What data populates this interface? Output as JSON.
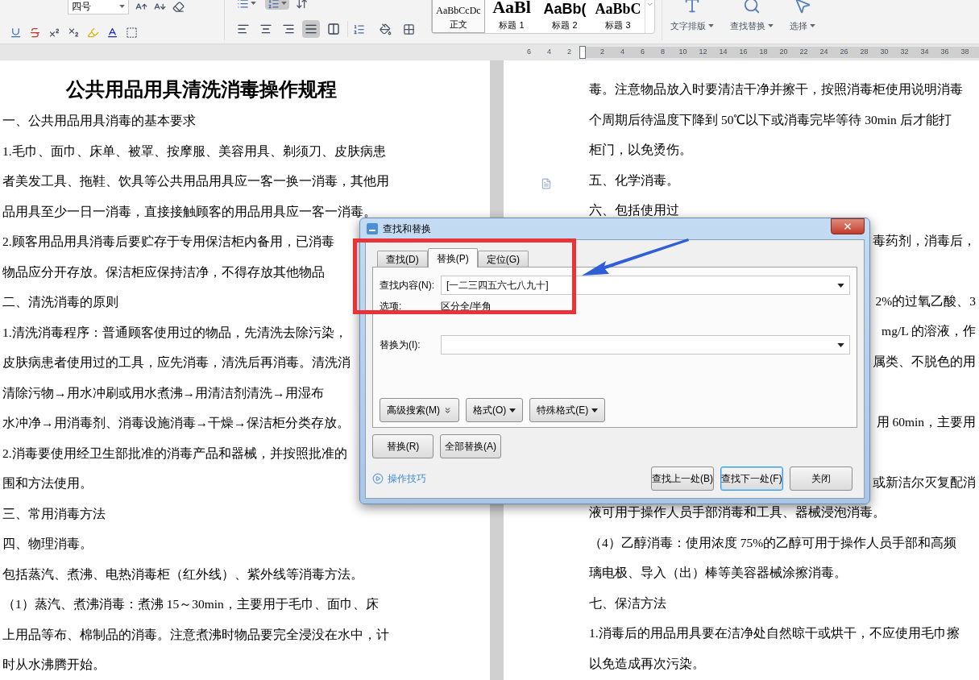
{
  "toolbar": {
    "font_size": "四号",
    "list_buttons": [
      {
        "kind": "bullets",
        "selected": false
      },
      {
        "kind": "numbering",
        "selected": true
      }
    ],
    "align_buttons": [
      {
        "kind": "left",
        "selected": false
      },
      {
        "kind": "center",
        "selected": false
      },
      {
        "kind": "right",
        "selected": false
      },
      {
        "kind": "justify",
        "selected": true
      },
      {
        "kind": "distributed",
        "selected": false
      }
    ],
    "styles": [
      {
        "kind": "body",
        "sample": "AaBbCcDc",
        "name": "正文",
        "selected": true
      },
      {
        "kind": "heading1",
        "sample": "AaBl",
        "name": "标题 1",
        "selected": false
      },
      {
        "kind": "heading2",
        "sample": "AaBb(",
        "name": "标题 2",
        "selected": false
      },
      {
        "kind": "heading3",
        "sample": "AaBbC",
        "name": "标题 3",
        "selected": false
      }
    ],
    "big_buttons": [
      {
        "kind": "layout",
        "label": "文字排版"
      },
      {
        "kind": "find",
        "label": "查找替换"
      },
      {
        "kind": "select",
        "label": "选择"
      }
    ]
  },
  "ruler": {
    "left_ticks": [
      "6",
      "4",
      "2"
    ],
    "right_ticks": [
      "2",
      "4",
      "6",
      "8",
      "10",
      "12",
      "14",
      "16",
      "18",
      "20",
      "22",
      "24",
      "26",
      "28",
      "30",
      "32",
      "34",
      "36",
      "38"
    ]
  },
  "left_page": {
    "title": "公共用品用具清洗消毒操作规程",
    "lines": [
      "一、公共用品用具消毒的基本要求",
      "1.毛巾、面巾、床单、被罩、按摩服、美容用具、剃须刀、皮肤病患",
      "者美发工具、拖鞋、饮具等公共用品用具应一客一换一消毒，其他用",
      "品用具至少一日一消毒，直接接触顾客的用品用具应一客一消毒。",
      "2.顾客用品用具消毒后要贮存于专用保洁柜内备用，已消毒",
      "物品应分开存放。保洁柜应保持洁净，不得存放其他物品",
      "二、清洗消毒的原则",
      "1.清洗消毒程序：普通顾客使用过的物品，先清洗去除污染，",
      "皮肤病患者使用过的工具，应先消毒，清洗后再消毒。清洗消",
      "清除污物→用水冲刷或用水煮沸→用清洁剂清洗→用湿布",
      "水冲净→用消毒剂、消毒设施消毒→干燥→保洁柜分类存放。",
      "2.消毒要使用经卫生部批准的消毒产品和器械，并按照批准的",
      "围和方法使用。",
      "三、常用消毒方法",
      "四、物理消毒。",
      "包括蒸汽、煮沸、电热消毒柜（红外线）、紫外线等消毒方法。",
      "（1）蒸汽、煮沸消毒：煮沸 15～30min，主要用于毛巾、面巾、床",
      "上用品等布、棉制品的消毒。注意煮沸时物品要完全浸没在水中，计",
      "时从水沸腾开始。"
    ]
  },
  "right_page": {
    "lines": [
      {
        "kind": "full",
        "text": "毒。注意物品放入时要清洁干净并擦干，按照消毒柜使用说明消毒"
      },
      {
        "kind": "full",
        "text": "个周期后待温度下降到 50℃以下或消毒完毕等待 30min 后才能打"
      },
      {
        "kind": "full",
        "text": "柜门，以免烫伤。"
      },
      {
        "kind": "full",
        "text": "五、化学消毒。"
      },
      {
        "kind": "full",
        "text": "六、包括使用过"
      },
      {
        "kind": "tail",
        "text": "毒药剂，消毒后，"
      },
      {
        "kind": "covered"
      },
      {
        "kind": "tail",
        "text": "2%的过氧乙酸、3"
      },
      {
        "kind": "tail",
        "text": "mg/L 的溶液，作"
      },
      {
        "kind": "tail",
        "text": "属类、不脱色的用"
      },
      {
        "kind": "covered"
      },
      {
        "kind": "tail",
        "text": "用 60min，主要用"
      },
      {
        "kind": "covered"
      },
      {
        "kind": "tail",
        "text": "或新洁尔灭复配消"
      },
      {
        "kind": "full",
        "text": "液可用于操作人员手部消毒和工具、器械浸泡消毒。"
      },
      {
        "kind": "full",
        "text": "（4）乙醇消毒：使用浓度 75%的乙醇可用于操作人员手部和高频"
      },
      {
        "kind": "full",
        "text": "璃电极、导入（出）棒等美容器械涂擦消毒。"
      },
      {
        "kind": "full",
        "text": "七、保洁方法"
      },
      {
        "kind": "full",
        "text": "1.消毒后的用品用具要在洁净处自然晾干或烘干，不应使用毛巾擦"
      },
      {
        "kind": "full",
        "text": "以免造成再次污染。"
      }
    ]
  },
  "dialog": {
    "title": "查找和替换",
    "tabs": [
      {
        "label": "查找(D)",
        "selected": false
      },
      {
        "label": "替换(P)",
        "selected": true
      },
      {
        "label": "定位(G)",
        "selected": false
      }
    ],
    "find_label": "查找内容(N):",
    "find_value": "[一二三四五六七八九十]",
    "options_label": "选项:",
    "options_value": "区分全/半角",
    "replace_label": "替换为(I):",
    "option_buttons": [
      {
        "kind": "expand",
        "label": "高级搜索(M)"
      },
      {
        "kind": "menu",
        "label": "格式(O)"
      },
      {
        "kind": "menu",
        "label": "特殊格式(E)"
      }
    ],
    "action_buttons": [
      "替换(R)",
      "全部替换(A)"
    ],
    "tips_link": "操作技巧",
    "bottom_buttons": [
      {
        "label": "查找上一处(B)",
        "focused": false
      },
      {
        "label": "查找下一处(F)",
        "focused": true
      },
      {
        "label": "关闭",
        "focused": false
      }
    ]
  }
}
